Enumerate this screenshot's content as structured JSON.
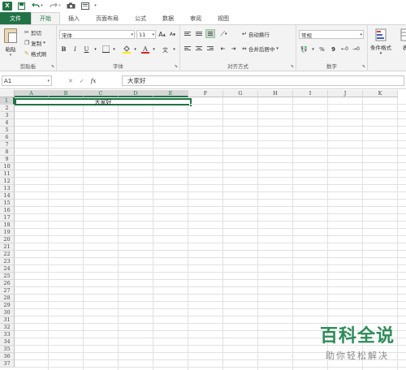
{
  "app": {
    "logo_letter": "X"
  },
  "quick_access": [
    "save-icon",
    "undo-icon",
    "redo-icon",
    "camera-icon",
    "print-preview-icon"
  ],
  "tabs": [
    {
      "label": "文件"
    },
    {
      "label": "开始"
    },
    {
      "label": "插入"
    },
    {
      "label": "页面布局"
    },
    {
      "label": "公式"
    },
    {
      "label": "数据"
    },
    {
      "label": "审阅"
    },
    {
      "label": "视图"
    }
  ],
  "ribbon": {
    "clipboard": {
      "paste": "粘贴",
      "cut": "剪切",
      "copy": "复制",
      "format_painter": "格式刷",
      "label": "剪贴板"
    },
    "font": {
      "name": "宋体",
      "size": "11",
      "label": "字体",
      "bold": "B",
      "italic": "I",
      "underline": "U",
      "grow": "A",
      "shrink": "A"
    },
    "alignment": {
      "wrap": "自动换行",
      "merge": "合并后居中",
      "label": "对齐方式"
    },
    "number": {
      "format": "常规",
      "percent": "%",
      "comma": "9",
      "label": "数字"
    },
    "styles": {
      "conditional": "条件格式",
      "label": "表"
    }
  },
  "formula_bar": {
    "name_box": "A1",
    "cancel": "✕",
    "enter": "✓",
    "fx": "fx",
    "content": "大家好"
  },
  "sheet": {
    "columns": [
      "A",
      "B",
      "C",
      "D",
      "E",
      "F",
      "G",
      "H",
      "I",
      "J",
      "K"
    ],
    "rows": [
      "1",
      "2",
      "3",
      "4",
      "5",
      "6",
      "7",
      "8",
      "9",
      "10",
      "11",
      "12",
      "13",
      "14",
      "15",
      "16",
      "17",
      "18",
      "19",
      "20",
      "21",
      "22",
      "23",
      "24",
      "25",
      "26",
      "27",
      "28",
      "29",
      "30",
      "31",
      "32",
      "33",
      "34",
      "35",
      "36",
      "37"
    ],
    "merged_cell_text": "大家好"
  },
  "watermark": {
    "main": "百科全说",
    "sub": "助你轻松解决"
  },
  "colors": {
    "accent": "#217346",
    "selection_fill": "#c6c6c6"
  }
}
